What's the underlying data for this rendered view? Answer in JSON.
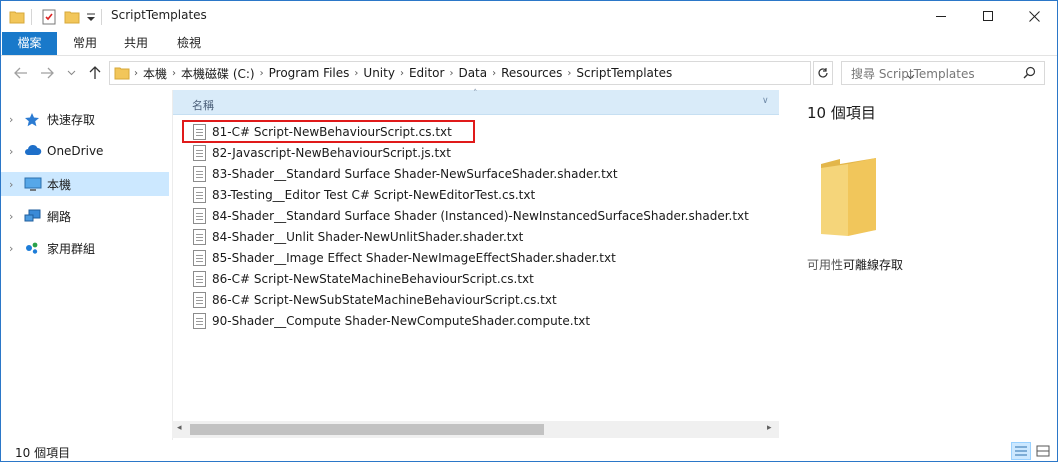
{
  "window": {
    "title": "ScriptTemplates"
  },
  "ribbon": {
    "tabs": [
      {
        "label": "檔案"
      },
      {
        "label": "常用"
      },
      {
        "label": "共用"
      },
      {
        "label": "檢視"
      }
    ]
  },
  "address": {
    "crumbs": [
      "本機",
      "本機磁碟 (C:)",
      "Program Files",
      "Unity",
      "Editor",
      "Data",
      "Resources",
      "ScriptTemplates"
    ]
  },
  "search": {
    "placeholder": "搜尋 ScriptTemplates"
  },
  "sidebar": {
    "items": [
      {
        "label": "快速存取",
        "icon": "star-icon"
      },
      {
        "label": "OneDrive",
        "icon": "cloud-icon"
      },
      {
        "label": "本機",
        "icon": "computer-icon",
        "selected": true
      },
      {
        "label": "網路",
        "icon": "network-icon"
      },
      {
        "label": "家用群組",
        "icon": "homegroup-icon"
      }
    ]
  },
  "filelist": {
    "column_name": "名稱",
    "files": [
      {
        "name": "81-C# Script-NewBehaviourScript.cs.txt",
        "highlighted": true
      },
      {
        "name": "82-Javascript-NewBehaviourScript.js.txt"
      },
      {
        "name": "83-Shader__Standard Surface Shader-NewSurfaceShader.shader.txt"
      },
      {
        "name": "83-Testing__Editor Test C# Script-NewEditorTest.cs.txt"
      },
      {
        "name": "84-Shader__Standard Surface Shader (Instanced)-NewInstancedSurfaceShader.shader.txt"
      },
      {
        "name": "84-Shader__Unlit Shader-NewUnlitShader.shader.txt"
      },
      {
        "name": "85-Shader__Image Effect Shader-NewImageEffectShader.shader.txt"
      },
      {
        "name": "86-C# Script-NewStateMachineBehaviourScript.cs.txt"
      },
      {
        "name": "86-C# Script-NewSubStateMachineBehaviourScript.cs.txt"
      },
      {
        "name": "90-Shader__Compute Shader-NewComputeShader.compute.txt"
      }
    ]
  },
  "details": {
    "count": "10 個項目",
    "availability_label": "可用性:",
    "availability_value": "可離線存取"
  },
  "status": {
    "count": "10 個項目"
  },
  "colors": {
    "accent": "#1979ca",
    "selection": "#cce8ff",
    "highlight_box": "#e01a1a",
    "folder": "#f2c65a"
  }
}
